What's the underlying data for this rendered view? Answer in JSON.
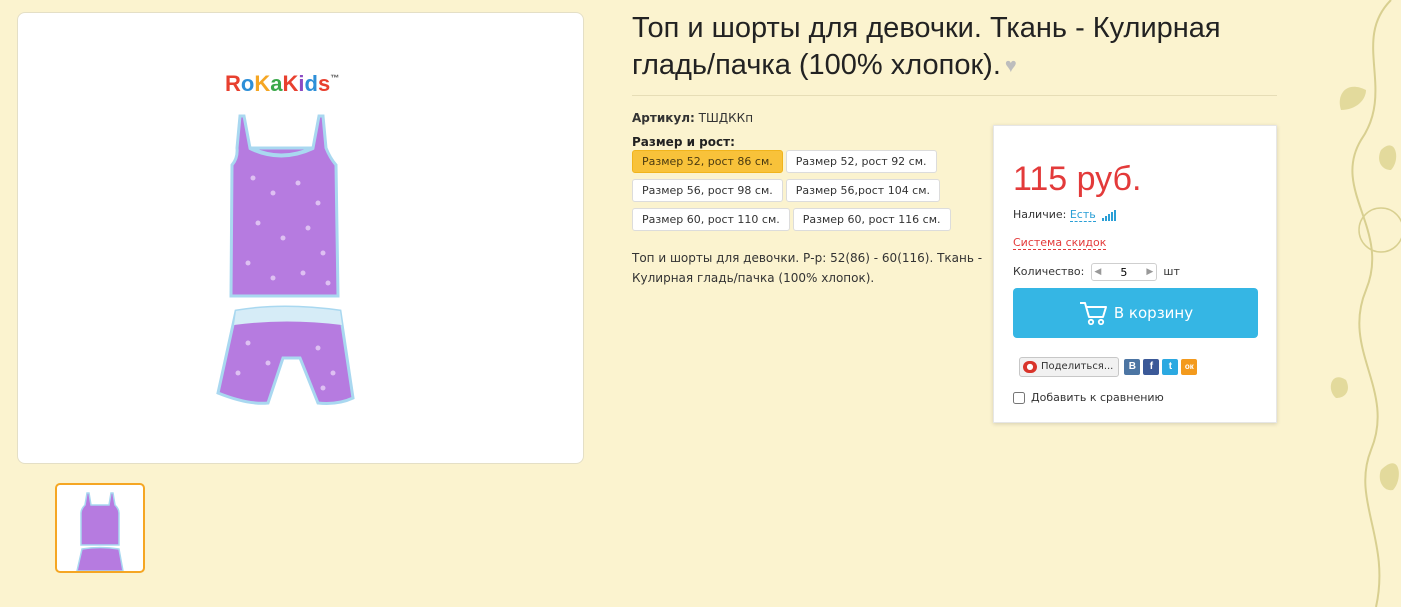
{
  "product": {
    "title": "Топ и шорты для девочки. Ткань - Кулирная гладь/пачка (100% хлопок).",
    "favorite_icon": "heart-icon",
    "sku_label": "Артикул:",
    "sku_value": "ТШДККп",
    "size_label": "Размер и рост:",
    "sizes": [
      {
        "label": "Размер 52, рост 86 см.",
        "selected": true
      },
      {
        "label": "Размер 52, рост 92 см.",
        "selected": false
      },
      {
        "label": "Размер 56, рост 98 см.",
        "selected": false
      },
      {
        "label": "Размер 56,рост 104 см.",
        "selected": false
      },
      {
        "label": "Размер 60, рост 110 см.",
        "selected": false
      },
      {
        "label": "Размер 60, рост 116 см.",
        "selected": false
      }
    ],
    "description": "Топ и шорты для девочки. Р-р: 52(86) - 60(116). Ткань - Кулирная гладь/пачка (100% хлопок).",
    "brand_logo": "RoKaKids™"
  },
  "purchase": {
    "price": "115 руб.",
    "availability_label": "Наличие:",
    "availability_value": "Есть",
    "discount_link": "Система скидок",
    "quantity_label": "Количество:",
    "quantity_value": "5",
    "quantity_unit": "шт",
    "cart_button": "В корзину",
    "share_button": "Поделиться...",
    "social": [
      "В",
      "f",
      "t",
      "ок"
    ],
    "compare_label": "Добавить к сравнению"
  },
  "colors": {
    "background": "#fbf3cf",
    "accent_blue": "#35b6e4",
    "price_red": "#e33a3a",
    "selected_size": "#f8c23a",
    "thumb_border": "#f5a623"
  }
}
